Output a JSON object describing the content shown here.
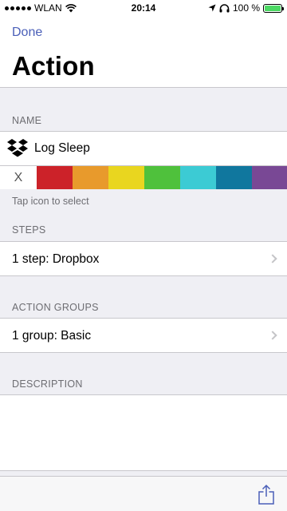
{
  "status": {
    "carrier": "WLAN",
    "time": "20:14",
    "battery": "100 %"
  },
  "nav": {
    "done_label": "Done",
    "title": "Action"
  },
  "name_section": {
    "header": "NAME",
    "name_value": "Log Sleep",
    "clear_label": "X",
    "colors": [
      "#cc2229",
      "#e89a2c",
      "#e9d61f",
      "#4fc13c",
      "#3ccbd4",
      "#10779e",
      "#794895"
    ],
    "footer": "Tap icon to select"
  },
  "steps_section": {
    "header": "STEPS",
    "row_label": "1 step: Dropbox"
  },
  "groups_section": {
    "header": "ACTION GROUPS",
    "row_label": "1 group: Basic"
  },
  "description_section": {
    "header": "DESCRIPTION"
  },
  "theme": {
    "accent": "#4a5fb8",
    "battery": "#4cd964"
  }
}
